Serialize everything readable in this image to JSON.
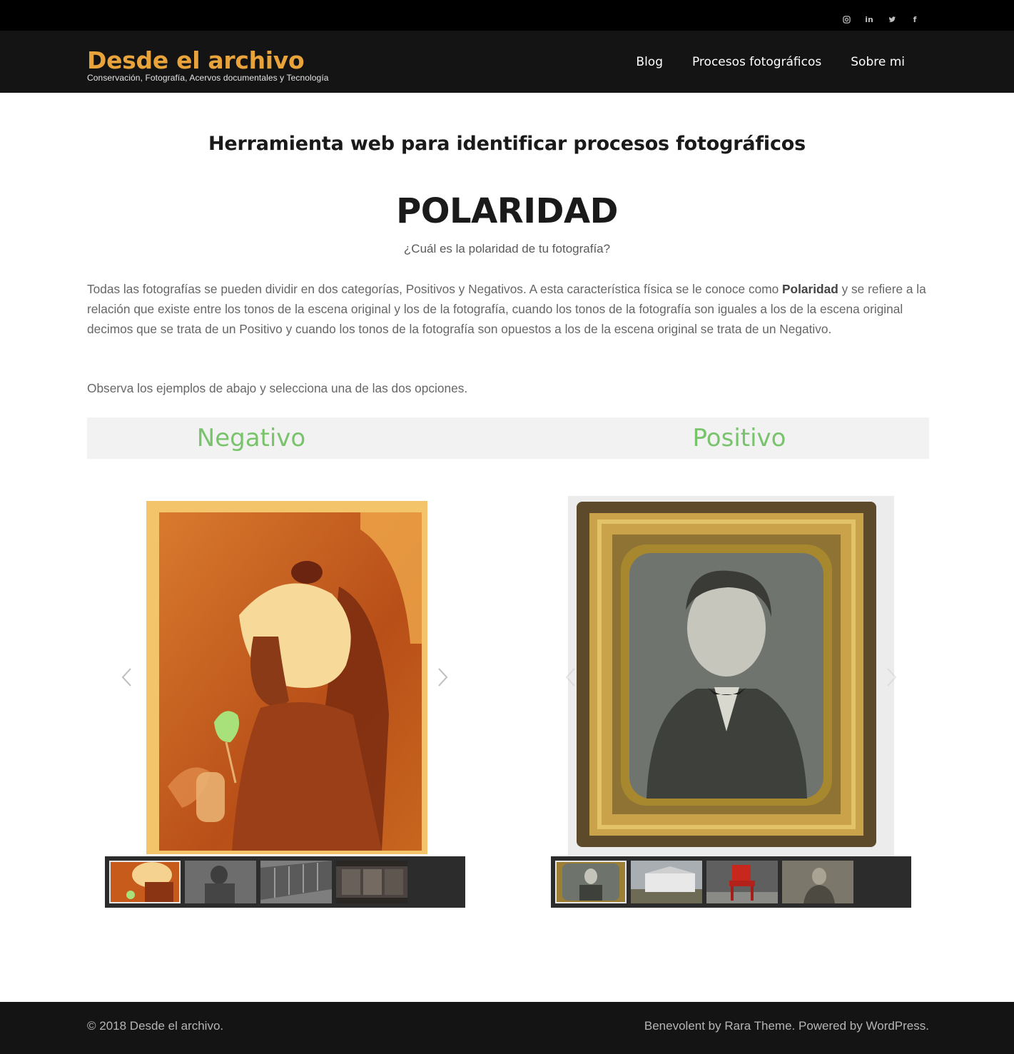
{
  "social": {
    "items": [
      {
        "icon": "instagram-icon"
      },
      {
        "icon": "linkedin-icon",
        "glyph": "in"
      },
      {
        "icon": "twitter-icon"
      },
      {
        "icon": "facebook-icon",
        "glyph": "f"
      }
    ]
  },
  "header": {
    "site_title": "Desde el archivo",
    "tagline": "Conservación, Fotografía, Acervos documentales y Tecnología",
    "nav": [
      "Blog",
      "Procesos fotográficos",
      "Sobre mi"
    ]
  },
  "main": {
    "page_title": "Herramienta web para identificar procesos fotográficos",
    "section_title": "POLARIDAD",
    "question": "¿Cuál es la polaridad de tu fotografía?",
    "para1_a": "Todas las fotografías se pueden dividir en dos categorías, Positivos y Negativos. A esta característica física se le conoce como ",
    "para1_bold": "Polaridad",
    "para1_b": " y se refiere a la relación que existe entre los tonos de la escena original y los de la fotografía, cuando los tonos de la fotografía son iguales a los de la escena original decimos que se trata de un Positivo y cuando los tonos de la fotografía son opuestos a los de la escena original se trata de un Negativo.",
    "para2": "Observa los ejemplos de abajo y selecciona una de las dos opciones.",
    "options": [
      "Negativo",
      "Positivo"
    ]
  },
  "colors": {
    "accent": "#e8a33a",
    "option_green": "#79c36d",
    "header_bg": "#141414"
  },
  "footer": {
    "copyright": "© 2018 Desde el archivo.",
    "theme_link": "Benevolent by Rara Theme.",
    "powered_prefix": " Powered by ",
    "powered_link": "WordPress",
    "powered_suffix": "."
  }
}
